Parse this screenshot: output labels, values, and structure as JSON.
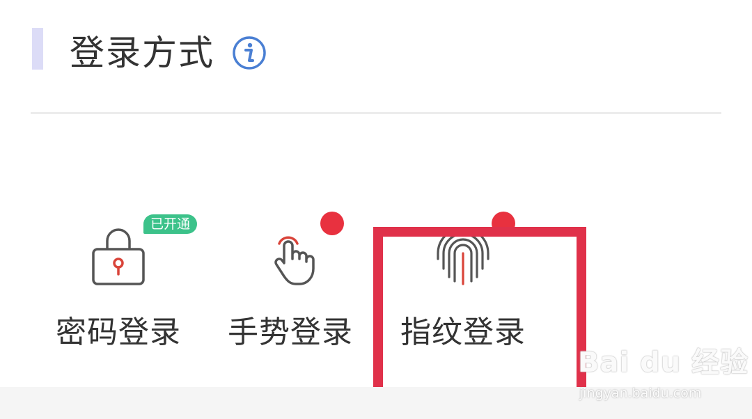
{
  "header": {
    "title": "登录方式",
    "info_icon": "info-circle-icon"
  },
  "options": [
    {
      "label": "密码登录",
      "icon": "lock-icon",
      "badge": "已开通"
    },
    {
      "label": "手势登录",
      "icon": "gesture-tap-icon"
    },
    {
      "label": "指纹登录",
      "icon": "fingerprint-icon"
    }
  ],
  "colors": {
    "accent_bar": "#dcdcf7",
    "info_blue": "#4a7fd3",
    "badge_green": "#3cc28a",
    "notify_red": "#e8313f",
    "highlight_red": "#e0314a",
    "icon_gray": "#555555",
    "icon_red": "#d9443a"
  },
  "watermark": {
    "brand": "Bai du 经验",
    "url": "jingyan.baidu.com"
  }
}
